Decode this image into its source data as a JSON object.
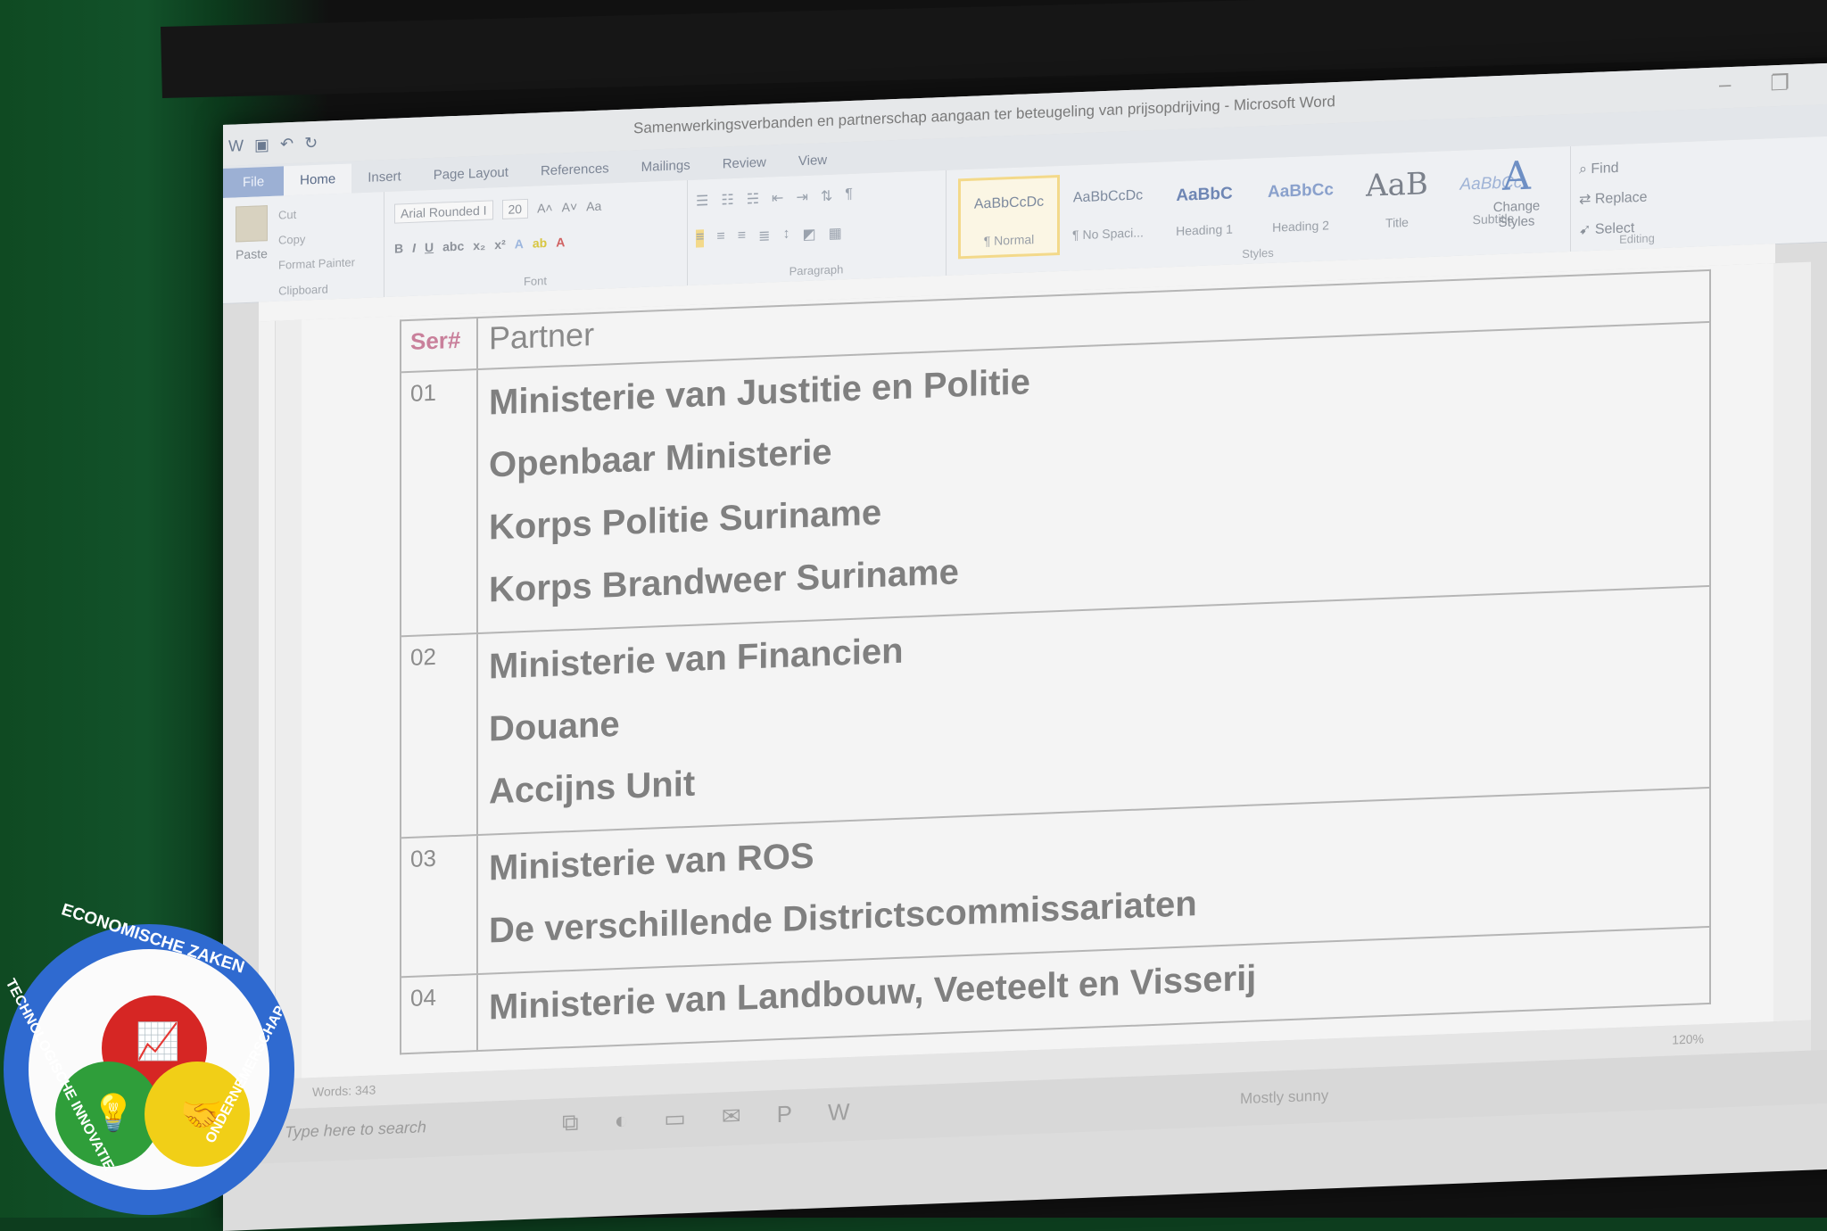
{
  "window": {
    "title": "Samenwerkingsverbanden en partnerschap aangaan ter beteugeling van prijsopdrijving - Microsoft Word",
    "controls": [
      "–",
      "❐",
      "✕"
    ]
  },
  "tabs": [
    {
      "label": "File"
    },
    {
      "label": "Home"
    },
    {
      "label": "Insert"
    },
    {
      "label": "Page Layout"
    },
    {
      "label": "References"
    },
    {
      "label": "Mailings"
    },
    {
      "label": "Review"
    },
    {
      "label": "View"
    }
  ],
  "ribbon": {
    "clipboard": {
      "paste": "Paste",
      "cut": "Cut",
      "copy": "Copy",
      "format_painter": "Format Painter",
      "label": "Clipboard"
    },
    "font": {
      "name": "Arial Rounded I",
      "size": "20",
      "label": "Font"
    },
    "paragraph": {
      "label": "Paragraph"
    },
    "styles": {
      "label": "Styles",
      "items": [
        {
          "sample": "AaBbCcDc",
          "name": "¶ Normal"
        },
        {
          "sample": "AaBbCcDc",
          "name": "¶ No Spaci..."
        },
        {
          "sample": "AaBbC",
          "name": "Heading 1"
        },
        {
          "sample": "AaBbCc",
          "name": "Heading 2"
        },
        {
          "sample": "AaB",
          "name": "Title"
        },
        {
          "sample": "AaBbCc.",
          "name": "Subtitle"
        }
      ],
      "change_styles": "Change Styles"
    },
    "editing": {
      "find": "Find",
      "replace": "Replace",
      "select": "Select",
      "label": "Editing"
    }
  },
  "table": {
    "header": {
      "ser": "Ser#",
      "partner": "Partner"
    },
    "rows": [
      {
        "ser": "01",
        "partners": [
          "Ministerie van Justitie en Politie",
          "Openbaar Ministerie",
          "Korps Politie Suriname",
          "Korps Brandweer Suriname"
        ]
      },
      {
        "ser": "02",
        "partners": [
          "Ministerie van Financien",
          "Douane",
          "Accijns Unit"
        ]
      },
      {
        "ser": "03",
        "partners": [
          "Ministerie van ROS",
          "De verschillende Districtscommissariaten"
        ]
      },
      {
        "ser": "04",
        "partners": [
          "Ministerie van Landbouw, Veeteelt en Visserij"
        ]
      }
    ]
  },
  "statusbar": {
    "words": "Words: 343",
    "zoom": "120%"
  },
  "taskbar": {
    "search_placeholder": "Type here to search",
    "weather": "Mostly sunny"
  },
  "logo": {
    "top": "ECONOMISCHE ZAKEN",
    "left": "TECHNOLOGISCHE INNOVATIE",
    "right": "ONDERNEMERSCHAP",
    "colors": {
      "ring": "#2f6ad0",
      "red": "#d62624",
      "green": "#2f9e3a",
      "yellow": "#f1cf17"
    }
  }
}
